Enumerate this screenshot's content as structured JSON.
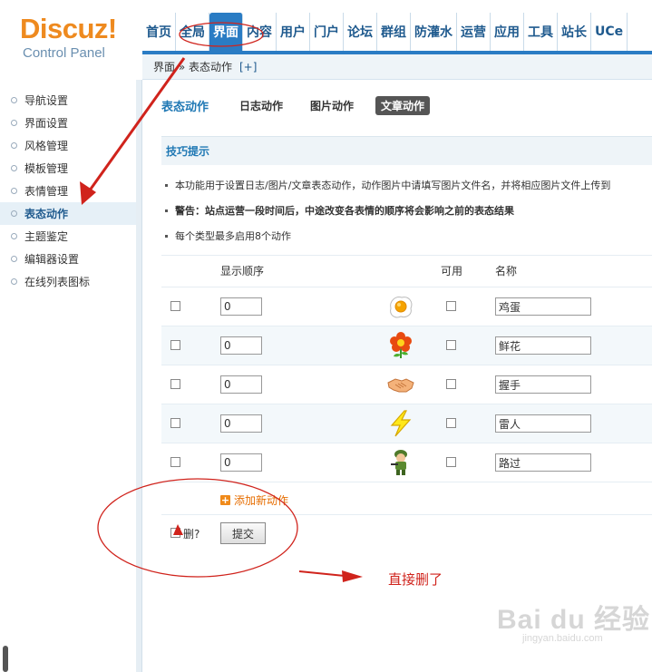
{
  "logo": {
    "main": "Discuz!",
    "sub": "Control Panel"
  },
  "topnav": [
    "首页",
    "全局",
    "界面",
    "内容",
    "用户",
    "门户",
    "论坛",
    "群组",
    "防灌水",
    "运营",
    "应用",
    "工具",
    "站长",
    "UCe"
  ],
  "topnav_active": "界面",
  "breadcrumb": {
    "text": "界面 » 表态动作",
    "plus": "[+]"
  },
  "sidebar": {
    "items": [
      "导航设置",
      "界面设置",
      "风格管理",
      "模板管理",
      "表情管理",
      "表态动作",
      "主题鉴定",
      "编辑器设置",
      "在线列表图标"
    ],
    "active": "表态动作"
  },
  "subtabs": {
    "title": "表态动作",
    "tabs": [
      "日志动作",
      "图片动作",
      "文章动作"
    ],
    "active": "文章动作"
  },
  "tips": {
    "title": "技巧提示",
    "lines": [
      "本功能用于设置日志/图片/文章表态动作，动作图片中请填写图片文件名，并将相应图片文件上传到",
      "警告：站点运营一段时间后，中途改变各表情的顺序将会影响之前的表态结果",
      "每个类型最多启用8个动作"
    ]
  },
  "table": {
    "headers": {
      "order": "显示顺序",
      "enabled": "可用",
      "name": "名称"
    },
    "rows": [
      {
        "order": "0",
        "icon": "fried-egg-icon",
        "name": "鸡蛋"
      },
      {
        "order": "0",
        "icon": "flower-icon",
        "name": "鲜花"
      },
      {
        "order": "0",
        "icon": "handshake-icon",
        "name": "握手"
      },
      {
        "order": "0",
        "icon": "lightning-icon",
        "name": "雷人"
      },
      {
        "order": "0",
        "icon": "soldier-icon",
        "name": "路过"
      }
    ]
  },
  "add_link": "添加新动作",
  "delete_label": "删?",
  "submit_label": "提交",
  "annotation": "直接删了",
  "watermark": {
    "main": "Bai du 经验",
    "sub": "jingyan.baidu.com"
  },
  "colors": {
    "accent": "#2a7cc4",
    "annotation": "#d0231c",
    "logo": "#ee8a1f"
  }
}
